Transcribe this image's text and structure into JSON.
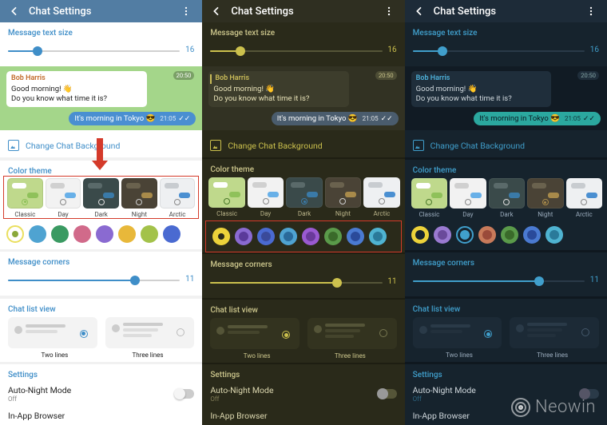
{
  "header": {
    "title": "Chat Settings"
  },
  "msg_size": {
    "label": "Message text size",
    "value": 16,
    "fill_pct": 16
  },
  "preview": {
    "time_badge": "20:50",
    "sender": "Bob Harris",
    "line1": "Good morning! 👋",
    "line2": "Do you know what time it is?",
    "reply": "It's morning in Tokyo 😎",
    "reply_time": "21:05",
    "checks": "✓✓"
  },
  "change_bg": "Change Chat Background",
  "color_theme_label": "Color theme",
  "themes": [
    {
      "name": "Classic",
      "bg": "#bfd98c",
      "b1": "#fff",
      "b2": "#8fc15a",
      "dot": "#4a7a2a"
    },
    {
      "name": "Day",
      "bg": "#f2f2f2",
      "b1": "#d0d0d0",
      "b2": "#68b0e8",
      "dot": "#888"
    },
    {
      "name": "Dark",
      "bg": "#3a4a4a",
      "b1": "#5a6a6a",
      "b2": "#3a7aa8",
      "dot": "#ddd"
    },
    {
      "name": "Night",
      "bg": "#4a4336",
      "b1": "#6a624e",
      "b2": "#a88a4a",
      "dot": "#ccc"
    },
    {
      "name": "Arctic",
      "bg": "#eef0f2",
      "b1": "#c8ccd0",
      "b2": "#4a8fd1",
      "dot": "#888"
    }
  ],
  "theme_selected": {
    "light": 0,
    "olive": 2,
    "night": 3
  },
  "swatches_light": [
    {
      "outer": "#eadf5e",
      "inner": "#8aa83a"
    },
    {
      "outer": "#4fa3d1",
      "inner": ""
    },
    {
      "outer": "#3a9a62",
      "inner": ""
    },
    {
      "outer": "#d16a8a",
      "inner": ""
    },
    {
      "outer": "#8a6ad1",
      "inner": ""
    },
    {
      "outer": "#e8b83a",
      "inner": ""
    },
    {
      "outer": "#a3c24a",
      "inner": ""
    },
    {
      "outer": "#4a6ad1",
      "inner": ""
    }
  ],
  "swatches_olive": [
    {
      "outer": "#ecd23a",
      "inner": "#2a2a1a"
    },
    {
      "outer": "#8a6ad1",
      "inner": "#5a3a9a"
    },
    {
      "outer": "#4a6ad1",
      "inner": "#3a4a9a"
    },
    {
      "outer": "#4fa3d1",
      "inner": "#2a6a9a"
    },
    {
      "outer": "#9a5ad1",
      "inner": "#6a3a9a"
    },
    {
      "outer": "#5a9a4a",
      "inner": "#3a6a2a"
    },
    {
      "outer": "#4a7ad1",
      "inner": "#2a4a9a"
    },
    {
      "outer": "#4fb3d1",
      "inner": "#2a7a9a"
    }
  ],
  "swatches_night": [
    {
      "outer": "#ecd23a",
      "inner": "#16232d"
    },
    {
      "outer": "#9a7ad1",
      "inner": "#6a4a9a"
    },
    {
      "outer": "#409fcc",
      "inner": "#16232d"
    },
    {
      "outer": "#c87a5a",
      "inner": "#9a4a3a"
    },
    {
      "outer": "#5a9a4a",
      "inner": "#3a6a2a"
    },
    {
      "outer": "#4a7ad1",
      "inner": "#2a4a9a"
    },
    {
      "outer": "#4fb3d1",
      "inner": "#2a7a9a"
    }
  ],
  "corners": {
    "label": "Message corners",
    "value": 11,
    "fill_pct": 68
  },
  "clv": {
    "label": "Chat list view",
    "two": "Two lines",
    "three": "Three lines"
  },
  "clv_selected": {
    "light": 0,
    "olive": 0,
    "night": 0
  },
  "settings_label": "Settings",
  "rows": [
    {
      "title": "Auto-Night Mode",
      "sub": "Off"
    },
    {
      "title": "In-App Browser",
      "sub": ""
    }
  ],
  "watermark": "Neowin"
}
